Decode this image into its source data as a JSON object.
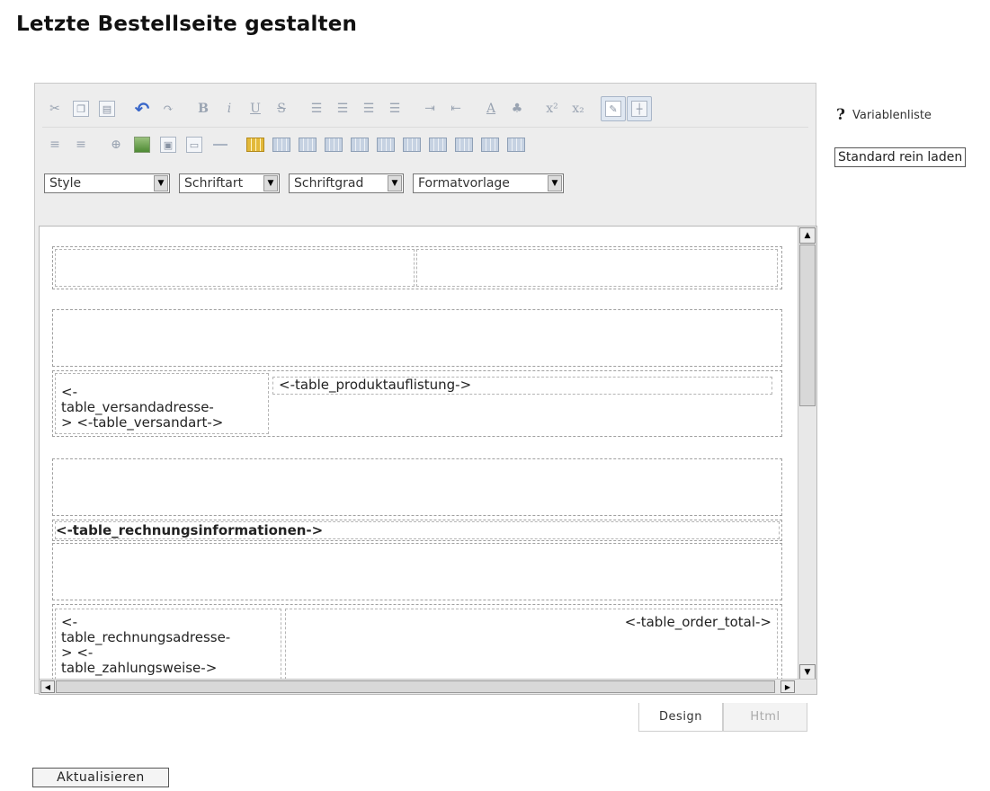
{
  "page": {
    "title": "Letzte Bestellseite gestalten"
  },
  "toolbar": {
    "row1": [
      "cut-icon",
      "copy-icon",
      "paste-icon",
      "undo-icon",
      "redo-icon",
      "bold-icon",
      "italic-icon",
      "underline-icon",
      "strikethrough-icon",
      "align-left-icon",
      "align-center-icon",
      "align-right-icon",
      "align-justify-icon",
      "indent-icon",
      "outdent-icon",
      "font-color-icon",
      "highlight-color-icon",
      "superscript-icon",
      "subscript-icon",
      "design-mode-icon",
      "show-borders-icon"
    ],
    "row2": [
      "ordered-list-icon",
      "unordered-list-icon",
      "link-icon",
      "image-icon",
      "media-icon",
      "form-icon",
      "horizontal-rule-icon",
      "insert-table-icon",
      "table-properties-icon",
      "cell-properties-icon",
      "insert-row-above-icon",
      "insert-row-below-icon",
      "insert-column-left-icon",
      "insert-column-right-icon",
      "delete-row-icon",
      "delete-column-icon",
      "merge-cells-icon",
      "split-cell-icon"
    ],
    "bold_glyph": "B",
    "italic_glyph": "i",
    "underline_glyph": "U",
    "strike_glyph": "S",
    "superscript_glyph": "x²",
    "subscript_glyph": "x₂",
    "font_color_glyph": "A"
  },
  "selects": {
    "style": "Style",
    "font": "Schriftart",
    "size": "Schriftgrad",
    "format": "Formatvorlage"
  },
  "content": {
    "versand_cell": "<-\ntable_versandadresse-\n> <-table_versandart->",
    "produkt_cell": "<-table_produktauflistung->",
    "rechnungsinfo": "<-table_rechnungsinformationen->",
    "rechnung_cell": "<-\ntable_rechnungsadresse-\n> <-\ntable_zahlungsweise->",
    "order_total": "<-table_order_total->"
  },
  "tabs": {
    "design": "Design",
    "html": "Html"
  },
  "sidebar": {
    "variable_list": "Variablenliste",
    "variable_icon_glyph": "?",
    "load_default": "Standard rein laden"
  },
  "footer": {
    "update": "Aktualisieren"
  }
}
